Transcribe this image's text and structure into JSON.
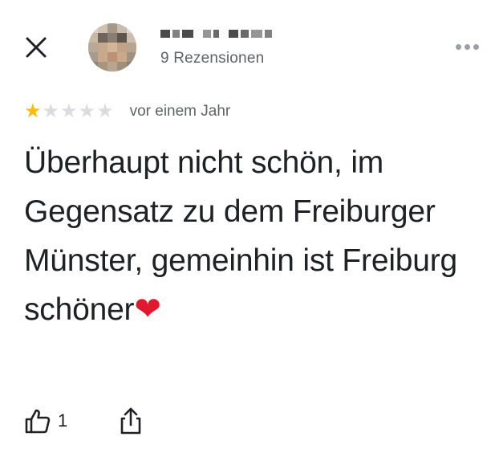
{
  "header": {
    "close_icon": "close-icon",
    "reviewer": {
      "name_redacted": true,
      "review_count": "9 Rezensionen"
    },
    "more_icon": "more-horizontal-icon"
  },
  "review": {
    "rating": 1,
    "max_rating": 5,
    "stars": [
      "★",
      "★",
      "★",
      "★",
      "★"
    ],
    "date": "vor einem Jahr",
    "text": "Überhaupt nicht schön, im Gegensatz zu dem Freiburger Münster, gemeinhin ist Freiburg schöner",
    "emoji": "❤"
  },
  "actions": {
    "like_icon": "thumbs-up-icon",
    "like_count": "1",
    "share_icon": "share-icon"
  },
  "colors": {
    "star_filled": "#fbbc04",
    "star_empty": "#dadce0",
    "secondary_text": "#5f6368",
    "primary_text": "#202124",
    "heart": "#e0192f"
  }
}
